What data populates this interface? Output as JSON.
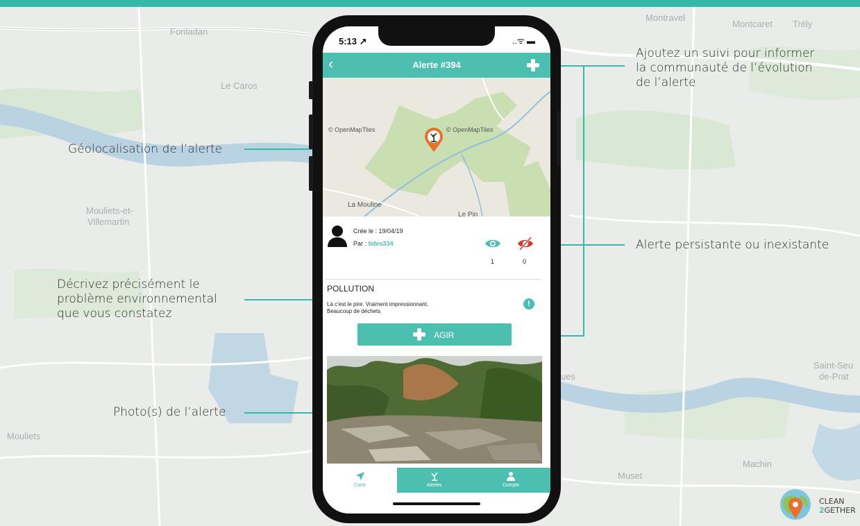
{
  "colors": {
    "accent": "#4dbfb0",
    "topbar": "#35b8aa",
    "danger": "#d9382b",
    "pin": "#e8702a"
  },
  "background_map": {
    "labels": [
      "Fonladan",
      "Le Caros",
      "Mouliets-et-",
      "Villemartin",
      "Mouliets",
      "Montravel",
      "Montcaret",
      "Trély",
      "Saint-Seu",
      "de-Prat",
      "Machin",
      "Muset",
      "ues"
    ]
  },
  "annotations": {
    "geoloc": "Géolocalisation de l’alerte",
    "describe": [
      "Décrivez précisément le",
      "problème environnemental",
      "que vous constatez"
    ],
    "photo": "Photo(s) de l’alerte",
    "follow": [
      "Ajoutez un suivi pour informer",
      "la communauté de l’évolution",
      "de l’alerte"
    ],
    "persist": "Alerte persistante ou inexistante"
  },
  "phone": {
    "status_time": "5:13 ↗",
    "status_icons": "..ᯤ ▬",
    "header": {
      "title": "Alerte #394",
      "back_icon": "chevron-left-icon",
      "add_icon": "plus-icon"
    },
    "mini_map": {
      "labels": [
        "© OpenMapTiles",
        "© OpenMapTiles",
        "La Mouline",
        "Le Pin"
      ]
    },
    "info": {
      "created": "Crée le : 19/04/19",
      "author_prefix": "Par : ",
      "author": "tides334",
      "seen_count": "1",
      "not_seen_count": "0"
    },
    "category": "POLLUTION",
    "description": [
      "Là c'est le pire. Vraiment impressionnant.",
      "Beaucoup de déchets"
    ],
    "excl": "!",
    "action_button": "AGIR",
    "tabs": [
      {
        "label": "Carte",
        "icon": "location-arrow-icon",
        "active": true
      },
      {
        "label": "Alertes",
        "icon": "dead-tree-icon",
        "active": false
      },
      {
        "label": "Compte",
        "icon": "user-icon",
        "active": false
      }
    ]
  },
  "logo": {
    "line1": "CLEAN",
    "line2_num": "2",
    "line2_rest": "GETHER"
  }
}
